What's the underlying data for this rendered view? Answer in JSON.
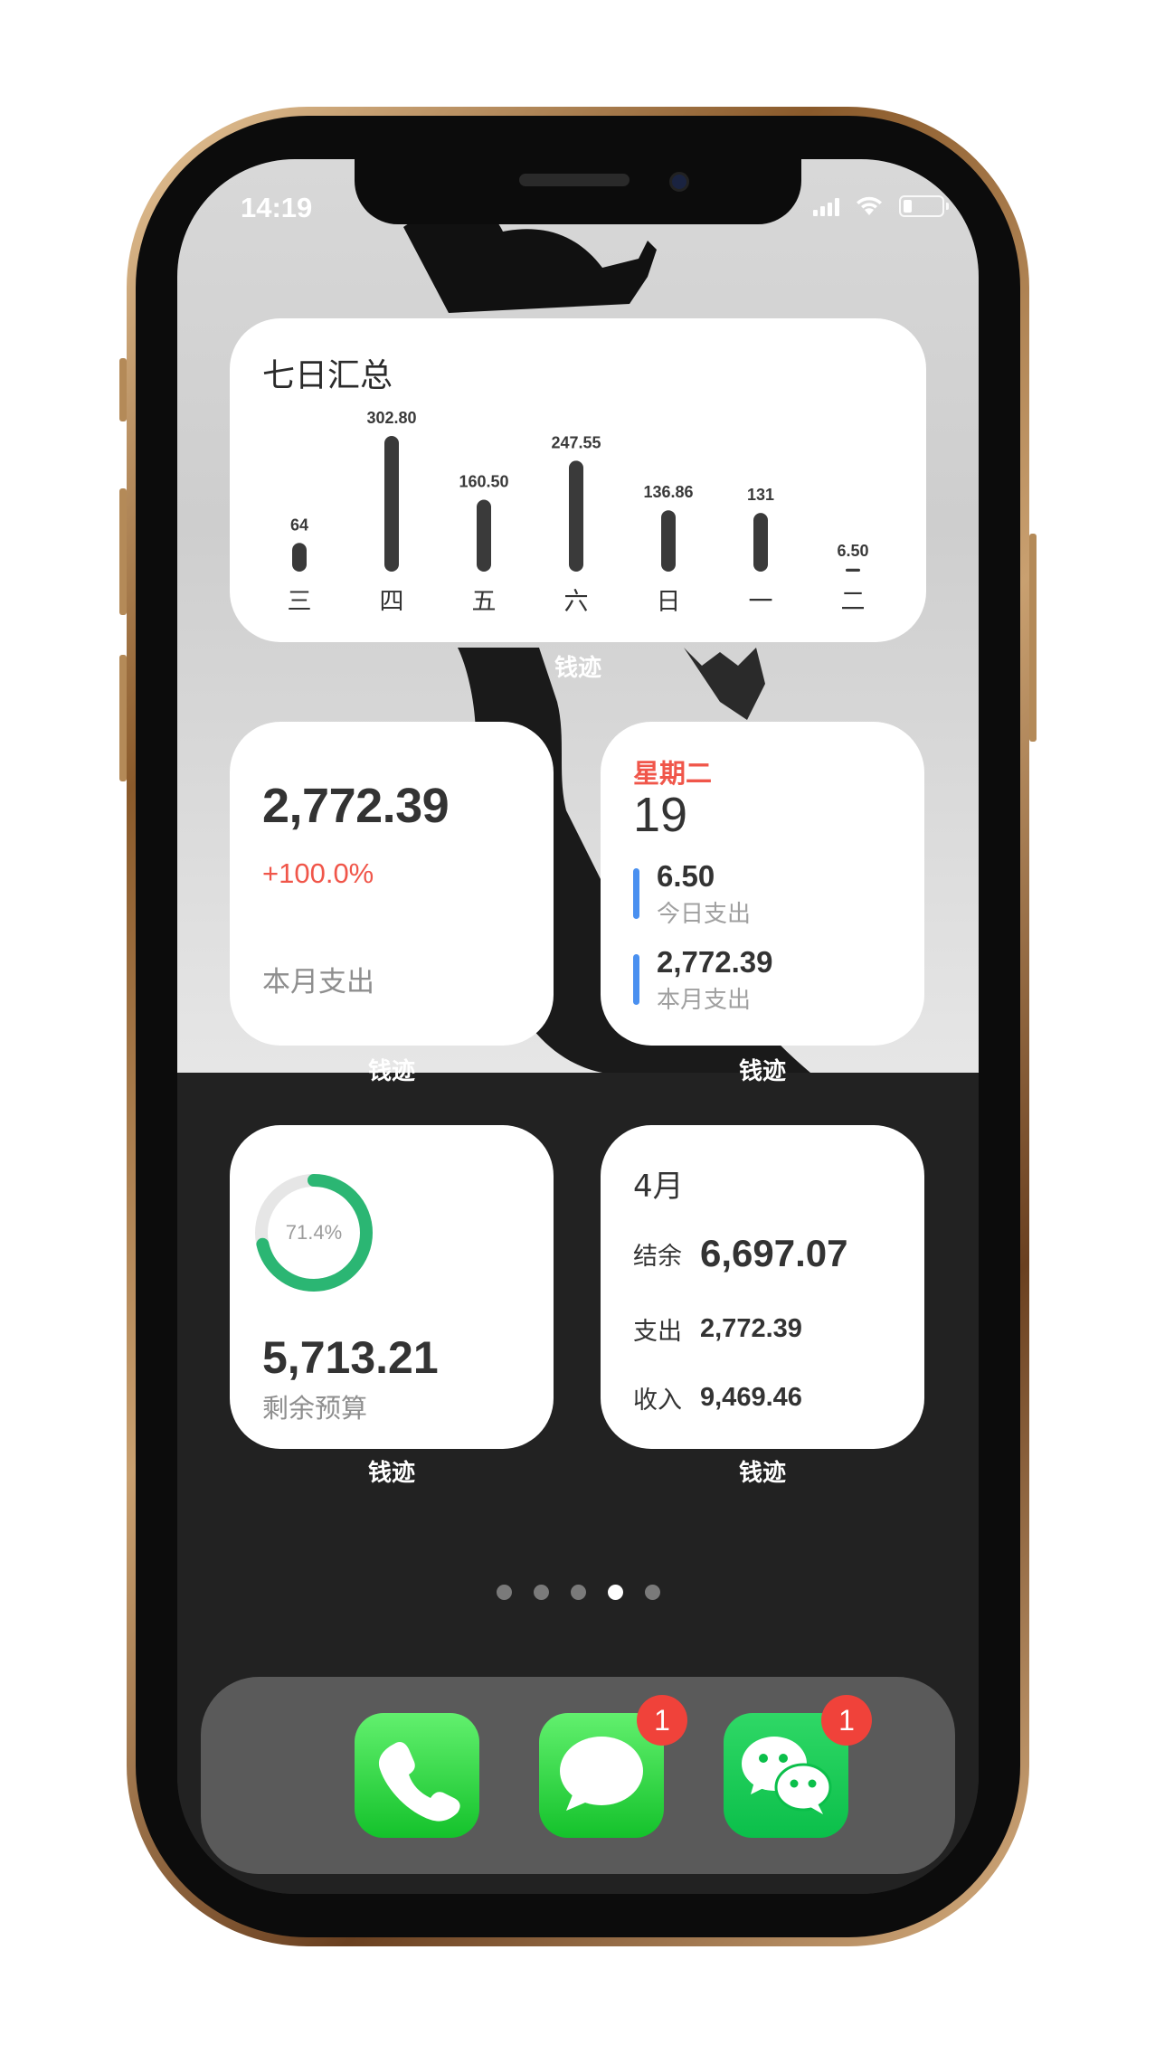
{
  "status_bar": {
    "time": "14:19"
  },
  "weekly_widget": {
    "title": "七日汇总",
    "app_label": "钱迹",
    "chart_data": {
      "type": "bar",
      "categories": [
        "三",
        "四",
        "五",
        "六",
        "日",
        "一",
        "二"
      ],
      "values": [
        64,
        302.8,
        160.5,
        247.55,
        136.86,
        131,
        6.5
      ],
      "value_labels": [
        "64",
        "302.80",
        "160.50",
        "247.55",
        "136.86",
        "131",
        "6.50"
      ],
      "title": "七日汇总",
      "bar_color": "#3a3a3a",
      "grid": false
    }
  },
  "month_widget": {
    "total": "2,772.39",
    "change": "+100.0%",
    "label": "本月支出",
    "app_label": "钱迹"
  },
  "day_widget": {
    "weekday": "星期二",
    "date": "19",
    "entries": [
      {
        "value": "6.50",
        "label": "今日支出"
      },
      {
        "value": "2,772.39",
        "label": "本月支出"
      }
    ],
    "app_label": "钱迹",
    "accent_color": "#4a90f0"
  },
  "budget_widget": {
    "percent_text": "71.4%",
    "percent_value": 0.714,
    "amount": "5,713.21",
    "label": "剩余预算",
    "app_label": "钱迹",
    "ring_color": "#2bb673",
    "track_color": "#e6e6e6"
  },
  "april_widget": {
    "title": "4月",
    "rows": [
      {
        "key": "结余",
        "value": "6,697.07"
      },
      {
        "key": "支出",
        "value": "2,772.39"
      },
      {
        "key": "收入",
        "value": "9,469.46"
      }
    ],
    "app_label": "钱迹"
  },
  "page_dots": {
    "count": 5,
    "active_index": 3
  },
  "dock": {
    "apps": [
      {
        "name": "phone",
        "icon": "phone-icon",
        "badge": ""
      },
      {
        "name": "messages",
        "icon": "message-bubble-icon",
        "badge": "1"
      },
      {
        "name": "wechat",
        "icon": "wechat-icon",
        "badge": "1"
      }
    ]
  },
  "colors": {
    "red_accent": "#f0564a",
    "green_app": "#2bd94d",
    "blue_accent": "#4a90f0"
  }
}
